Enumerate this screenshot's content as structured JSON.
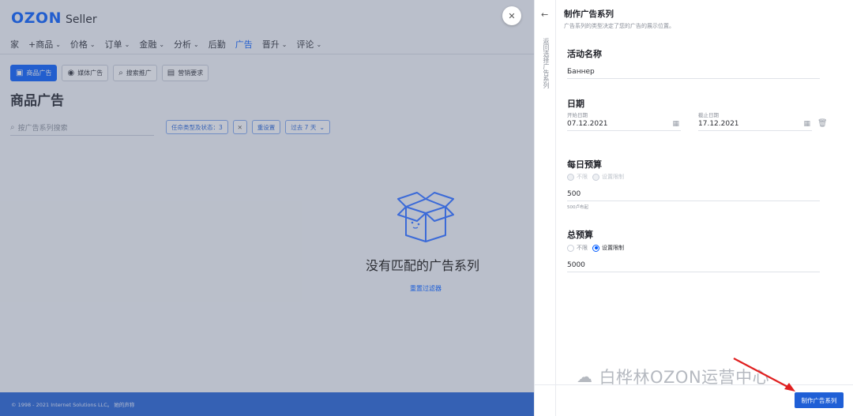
{
  "brand": {
    "logo": "OZON",
    "sub": "Seller"
  },
  "nav": [
    {
      "label": "家",
      "chev": false
    },
    {
      "label": "+商品",
      "chev": true
    },
    {
      "label": "价格",
      "chev": true
    },
    {
      "label": "订单",
      "chev": true
    },
    {
      "label": "金融",
      "chev": true
    },
    {
      "label": "分析",
      "chev": true
    },
    {
      "label": "后勤",
      "chev": false
    },
    {
      "label": "广告",
      "chev": false,
      "active": true
    },
    {
      "label": "晋升",
      "chev": true
    },
    {
      "label": "评论",
      "chev": true
    }
  ],
  "tabs": [
    {
      "label": "商品广告",
      "icon": "megaphone-icon"
    },
    {
      "label": "媒体广告",
      "icon": "eye-icon"
    },
    {
      "label": "搜索推广",
      "icon": "search-list-icon"
    },
    {
      "label": "营销要求",
      "icon": "document-icon"
    }
  ],
  "page_title": "商品广告",
  "search": {
    "placeholder": "按广告系列搜索"
  },
  "filters": {
    "type_status": "任命类型及状态：3",
    "reset": "重设置",
    "period": "过去 7 天"
  },
  "empty": {
    "title": "没有匹配的广告系列",
    "link": "重置过滤器"
  },
  "footer": {
    "text": "© 1998 - 2021 Internet Solutions LLC。 她的声称"
  },
  "panel": {
    "side_label": "返回选择广告系列",
    "title": "制作广告系列",
    "subtitle": "广告系列的类型决定了您的广告的展示位置。",
    "campaign_name": {
      "title": "活动名称",
      "value": "Баннер"
    },
    "dates": {
      "title": "日期",
      "start_label": "开始日期",
      "start_value": "07.12.2021",
      "end_label": "截止日期",
      "end_value": "17.12.2021"
    },
    "daily_budget": {
      "title": "每日预算",
      "opt_unlimited": "不限",
      "opt_set": "设置限制",
      "value": "500",
      "hint": "500卢布起"
    },
    "total_budget": {
      "title": "总预算",
      "opt_unlimited": "不限",
      "opt_set": "设置限制",
      "value": "5000"
    },
    "create_button": "制作广告系列"
  },
  "watermark": "白桦林OZON运营中心",
  "colors": {
    "accent": "#005bff",
    "button": "#1f5fd6",
    "footer": "#1f5fd6",
    "arrow": "#e02020"
  }
}
